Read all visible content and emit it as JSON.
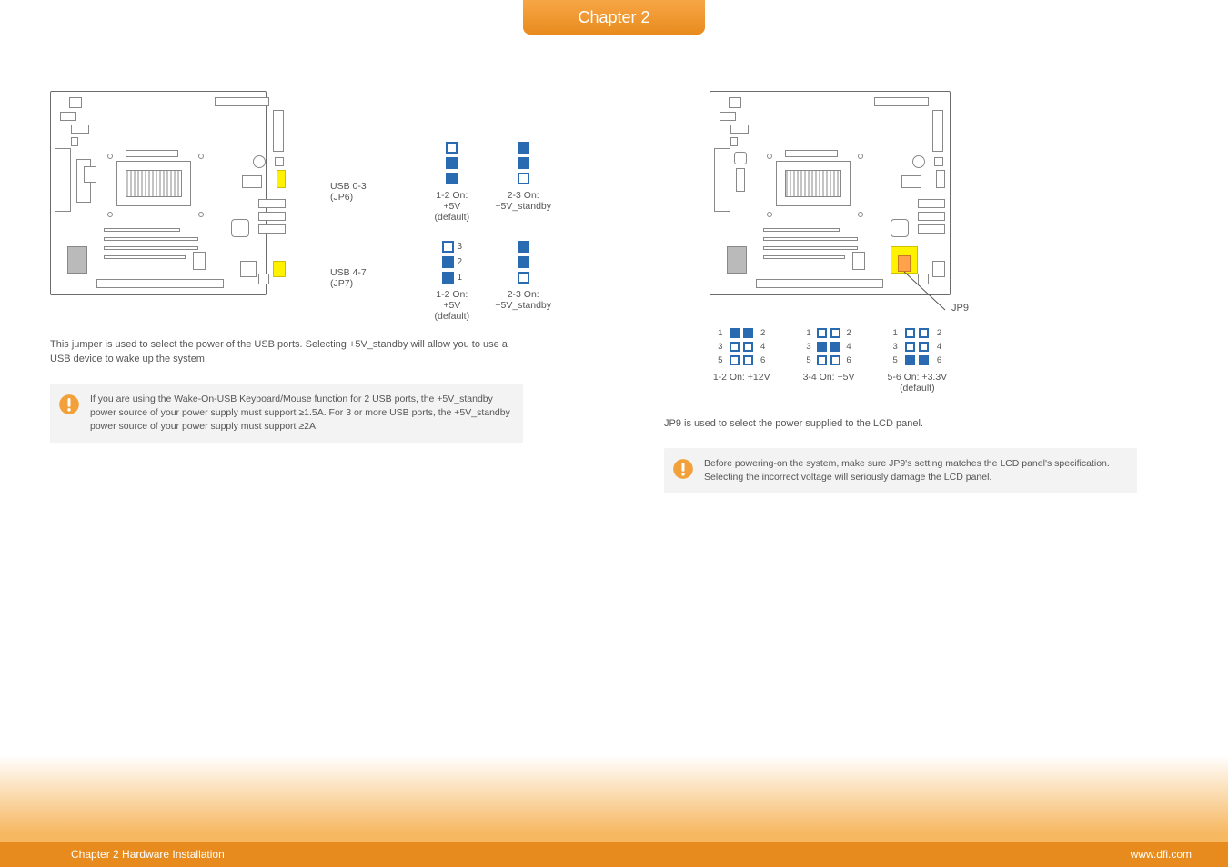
{
  "header": {
    "chapter_tab": "Chapter 2"
  },
  "footer": {
    "left": "Chapter 2 Hardware Installation",
    "right": "www.dfi.com"
  },
  "left": {
    "labels": {
      "usb03": "USB 0-3",
      "usb03_jp": "(JP6)",
      "usb47": "USB 4-7",
      "usb47_jp": "(JP7)"
    },
    "jumpers": {
      "top": {
        "opt1": "1-2 On: +5V",
        "opt1_sub": "(default)",
        "opt2_line1": "2-3 On:",
        "opt2_line2": "+5V_standby"
      },
      "bottom": {
        "pin3": "3",
        "pin2": "2",
        "pin1": "1",
        "opt1": "1-2 On: +5V",
        "opt1_sub": "(default)",
        "opt2_line1": "2-3 On:",
        "opt2_line2": "+5V_standby"
      }
    },
    "body": "This jumper is used to select the power of the USB ports. Selecting +5V_standby will allow you to use a USB device to wake up the system.",
    "note": "If you are using the Wake-On-USB Keyboard/Mouse function for 2 USB ports, the +5V_standby power source of your power supply must support ≥1.5A. For 3 or more USB ports, the +5V_standby power source of your power supply must support ≥2A."
  },
  "right": {
    "jp_label": "JP9",
    "jumpers": {
      "pins": {
        "p1": "1",
        "p2": "2",
        "p3": "3",
        "p4": "4",
        "p5": "5",
        "p6": "6"
      },
      "opt1": "1-2 On: +12V",
      "opt2": "3-4 On: +5V",
      "opt3_line1": "5-6 On: +3.3V",
      "opt3_line2": "(default)"
    },
    "body": "JP9 is used to select the power supplied to the LCD panel.",
    "note": "Before powering-on the system, make sure JP9's setting matches the LCD panel's specification. Selecting the incorrect voltage will seriously damage the LCD panel."
  }
}
